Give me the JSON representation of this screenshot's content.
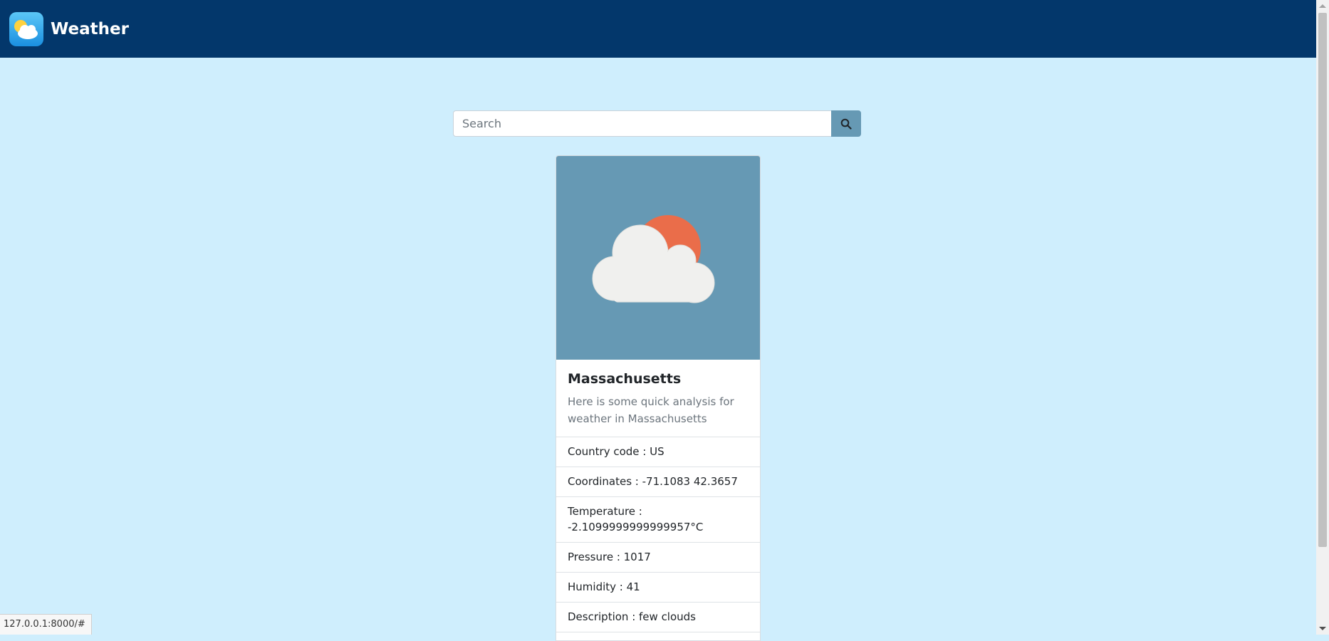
{
  "navbar": {
    "brand_title": "Weather",
    "logo_icon": "sun-cloud-icon"
  },
  "search": {
    "placeholder": "Search",
    "value": "",
    "button_icon": "search-icon"
  },
  "card": {
    "image_icon": "cloud-sun-icon",
    "title": "Massachusetts",
    "subtitle": "Here is some quick analysis for weather in Massachusetts",
    "items": [
      "Country code : US",
      "Coordinates : -71.1083 42.3657",
      "Temperature : -2.1099999999999957°C",
      "Pressure : 1017",
      "Humidity : 41",
      "Description : few clouds"
    ]
  },
  "status_bar": {
    "url": "127.0.0.1:8000/#"
  },
  "colors": {
    "navbar": "#03376b",
    "page_background": "#cfeefd",
    "accent": "#6699b4",
    "sun": "#ea6d4a",
    "cloud": "#f0f0ee"
  }
}
